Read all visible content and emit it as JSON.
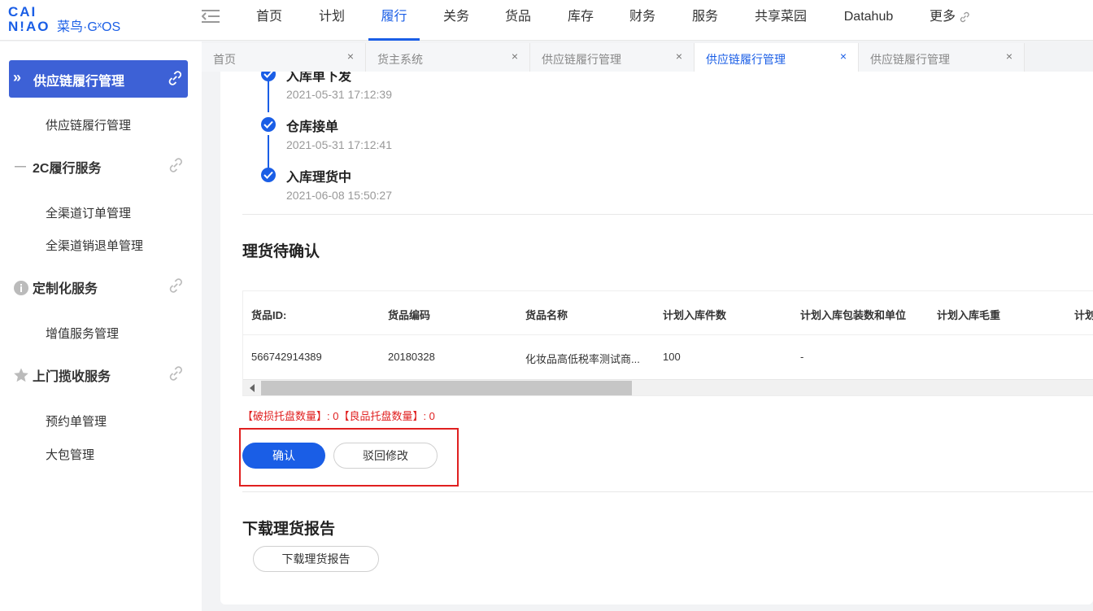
{
  "brand": {
    "line1": "CAI",
    "line2": "N!AO",
    "sub": "菜鸟·GˣOS",
    "accent": "#1a5ee6"
  },
  "top_nav": {
    "items": [
      "首页",
      "计划",
      "履行",
      "关务",
      "货品",
      "库存",
      "财务",
      "服务",
      "共享菜园",
      "Datahub"
    ],
    "active": "履行",
    "more_label": "更多"
  },
  "sidebar": {
    "header_label": "供应链履行管理",
    "groups": [
      {
        "title": "",
        "items": [
          "供应链履行管理"
        ]
      },
      {
        "title": "2C履行服务",
        "icon": "dash-icon",
        "items": [
          "全渠道订单管理",
          "全渠道销退单管理"
        ]
      },
      {
        "title": "定制化服务",
        "icon": "info-icon",
        "items": [
          "增值服务管理"
        ]
      },
      {
        "title": "上门揽收服务",
        "icon": "star-icon",
        "items": [
          "预约单管理",
          "大包管理"
        ]
      }
    ]
  },
  "tabs": [
    {
      "label": "首页",
      "active": false
    },
    {
      "label": "货主系统",
      "active": false
    },
    {
      "label": "供应链履行管理",
      "active": false
    },
    {
      "label": "供应链履行管理",
      "active": true
    },
    {
      "label": "供应链履行管理",
      "active": false
    }
  ],
  "timeline": [
    {
      "title": "入库单下发",
      "time": "2021-05-31 17:12:39"
    },
    {
      "title": "仓库接单",
      "time": "2021-05-31 17:12:41"
    },
    {
      "title": "入库理货中",
      "time": "2021-06-08 15:50:27"
    }
  ],
  "confirm_section": {
    "title": "理货待确认",
    "table": {
      "headers": [
        "货品ID:",
        "货品编码",
        "货品名称",
        "计划入库件数",
        "计划入库包装数和单位",
        "计划入库毛重",
        "计划"
      ],
      "rows": [
        [
          "566742914389",
          "20180328",
          "化妆品高低税率测试商...",
          "100",
          "-"
        ]
      ]
    },
    "pallet_text": "【破损托盘数量】: 0【良品托盘数量】: 0",
    "confirm_label": "确认",
    "reject_label": "驳回修改"
  },
  "report_section": {
    "title": "下载理货报告",
    "button_label": "下载理货报告"
  }
}
